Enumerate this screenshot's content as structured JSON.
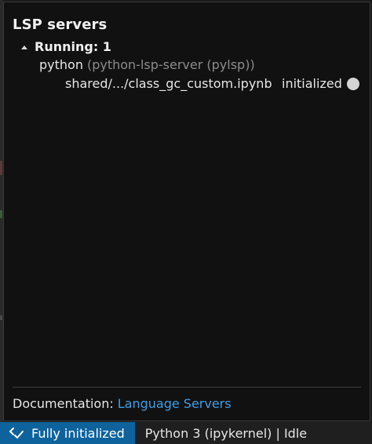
{
  "popup": {
    "title": "LSP servers",
    "group": {
      "label": "Running: 1",
      "server": {
        "name": "python",
        "detail": "(python-lsp-server (pylsp))",
        "document": {
          "path": "shared/.../class_gc_custom.ipynb",
          "status": "initialized",
          "status_icon": "circle-icon",
          "status_color": "#d4d4d4"
        }
      }
    },
    "footer": {
      "label": "Documentation:",
      "link_text": "Language Servers",
      "link_color": "#3f9ee6"
    }
  },
  "statusbar": {
    "lsp_label": "Fully initialized",
    "lsp_icon": "lsp-check-icon",
    "lsp_bg": "#0e639c",
    "kernel_label": "Python 3 (ipykernel) | Idle"
  }
}
